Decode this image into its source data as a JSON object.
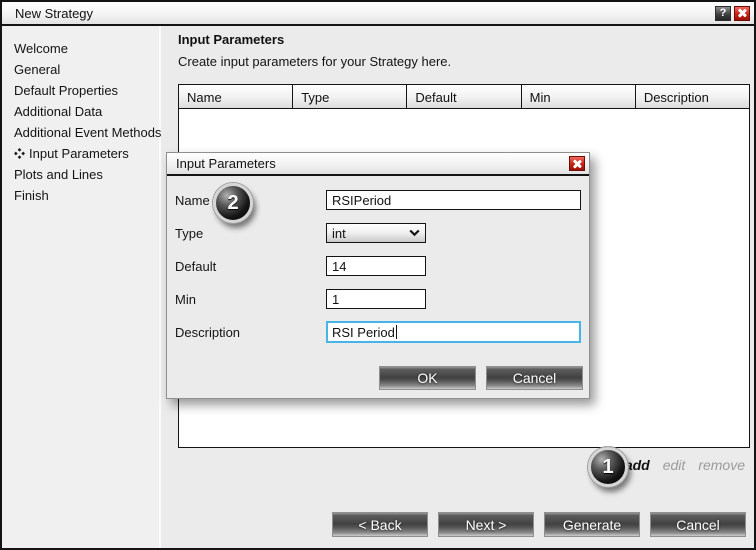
{
  "window": {
    "title": "New Strategy",
    "help_icon": "?"
  },
  "sidebar": {
    "items": [
      {
        "label": "Welcome"
      },
      {
        "label": "General"
      },
      {
        "label": "Default Properties"
      },
      {
        "label": "Additional Data"
      },
      {
        "label": "Additional Event Methods"
      },
      {
        "label": "Input Parameters",
        "active": true
      },
      {
        "label": "Plots and Lines"
      },
      {
        "label": "Finish"
      }
    ]
  },
  "main": {
    "heading": "Input Parameters",
    "subtitle": "Create input parameters for your Strategy here.",
    "table": {
      "columns": [
        "Name",
        "Type",
        "Default",
        "Min",
        "Description"
      ],
      "rows": []
    },
    "links": {
      "add": "add",
      "edit": "edit",
      "remove": "remove"
    },
    "buttons": {
      "back": "< Back",
      "next": "Next >",
      "generate": "Generate",
      "cancel": "Cancel"
    }
  },
  "dialog": {
    "title": "Input Parameters",
    "fields": {
      "name": {
        "label": "Name",
        "value": "RSIPeriod"
      },
      "type": {
        "label": "Type",
        "value": "int"
      },
      "default": {
        "label": "Default",
        "value": "14"
      },
      "min": {
        "label": "Min",
        "value": "1"
      },
      "description": {
        "label": "Description",
        "value": "RSI Period"
      }
    },
    "buttons": {
      "ok": "OK",
      "cancel": "Cancel"
    }
  },
  "annotations": {
    "step1": "1",
    "step2": "2"
  },
  "colors": {
    "focus_border": "#45b5e5",
    "close_button_red": "#c52415"
  }
}
